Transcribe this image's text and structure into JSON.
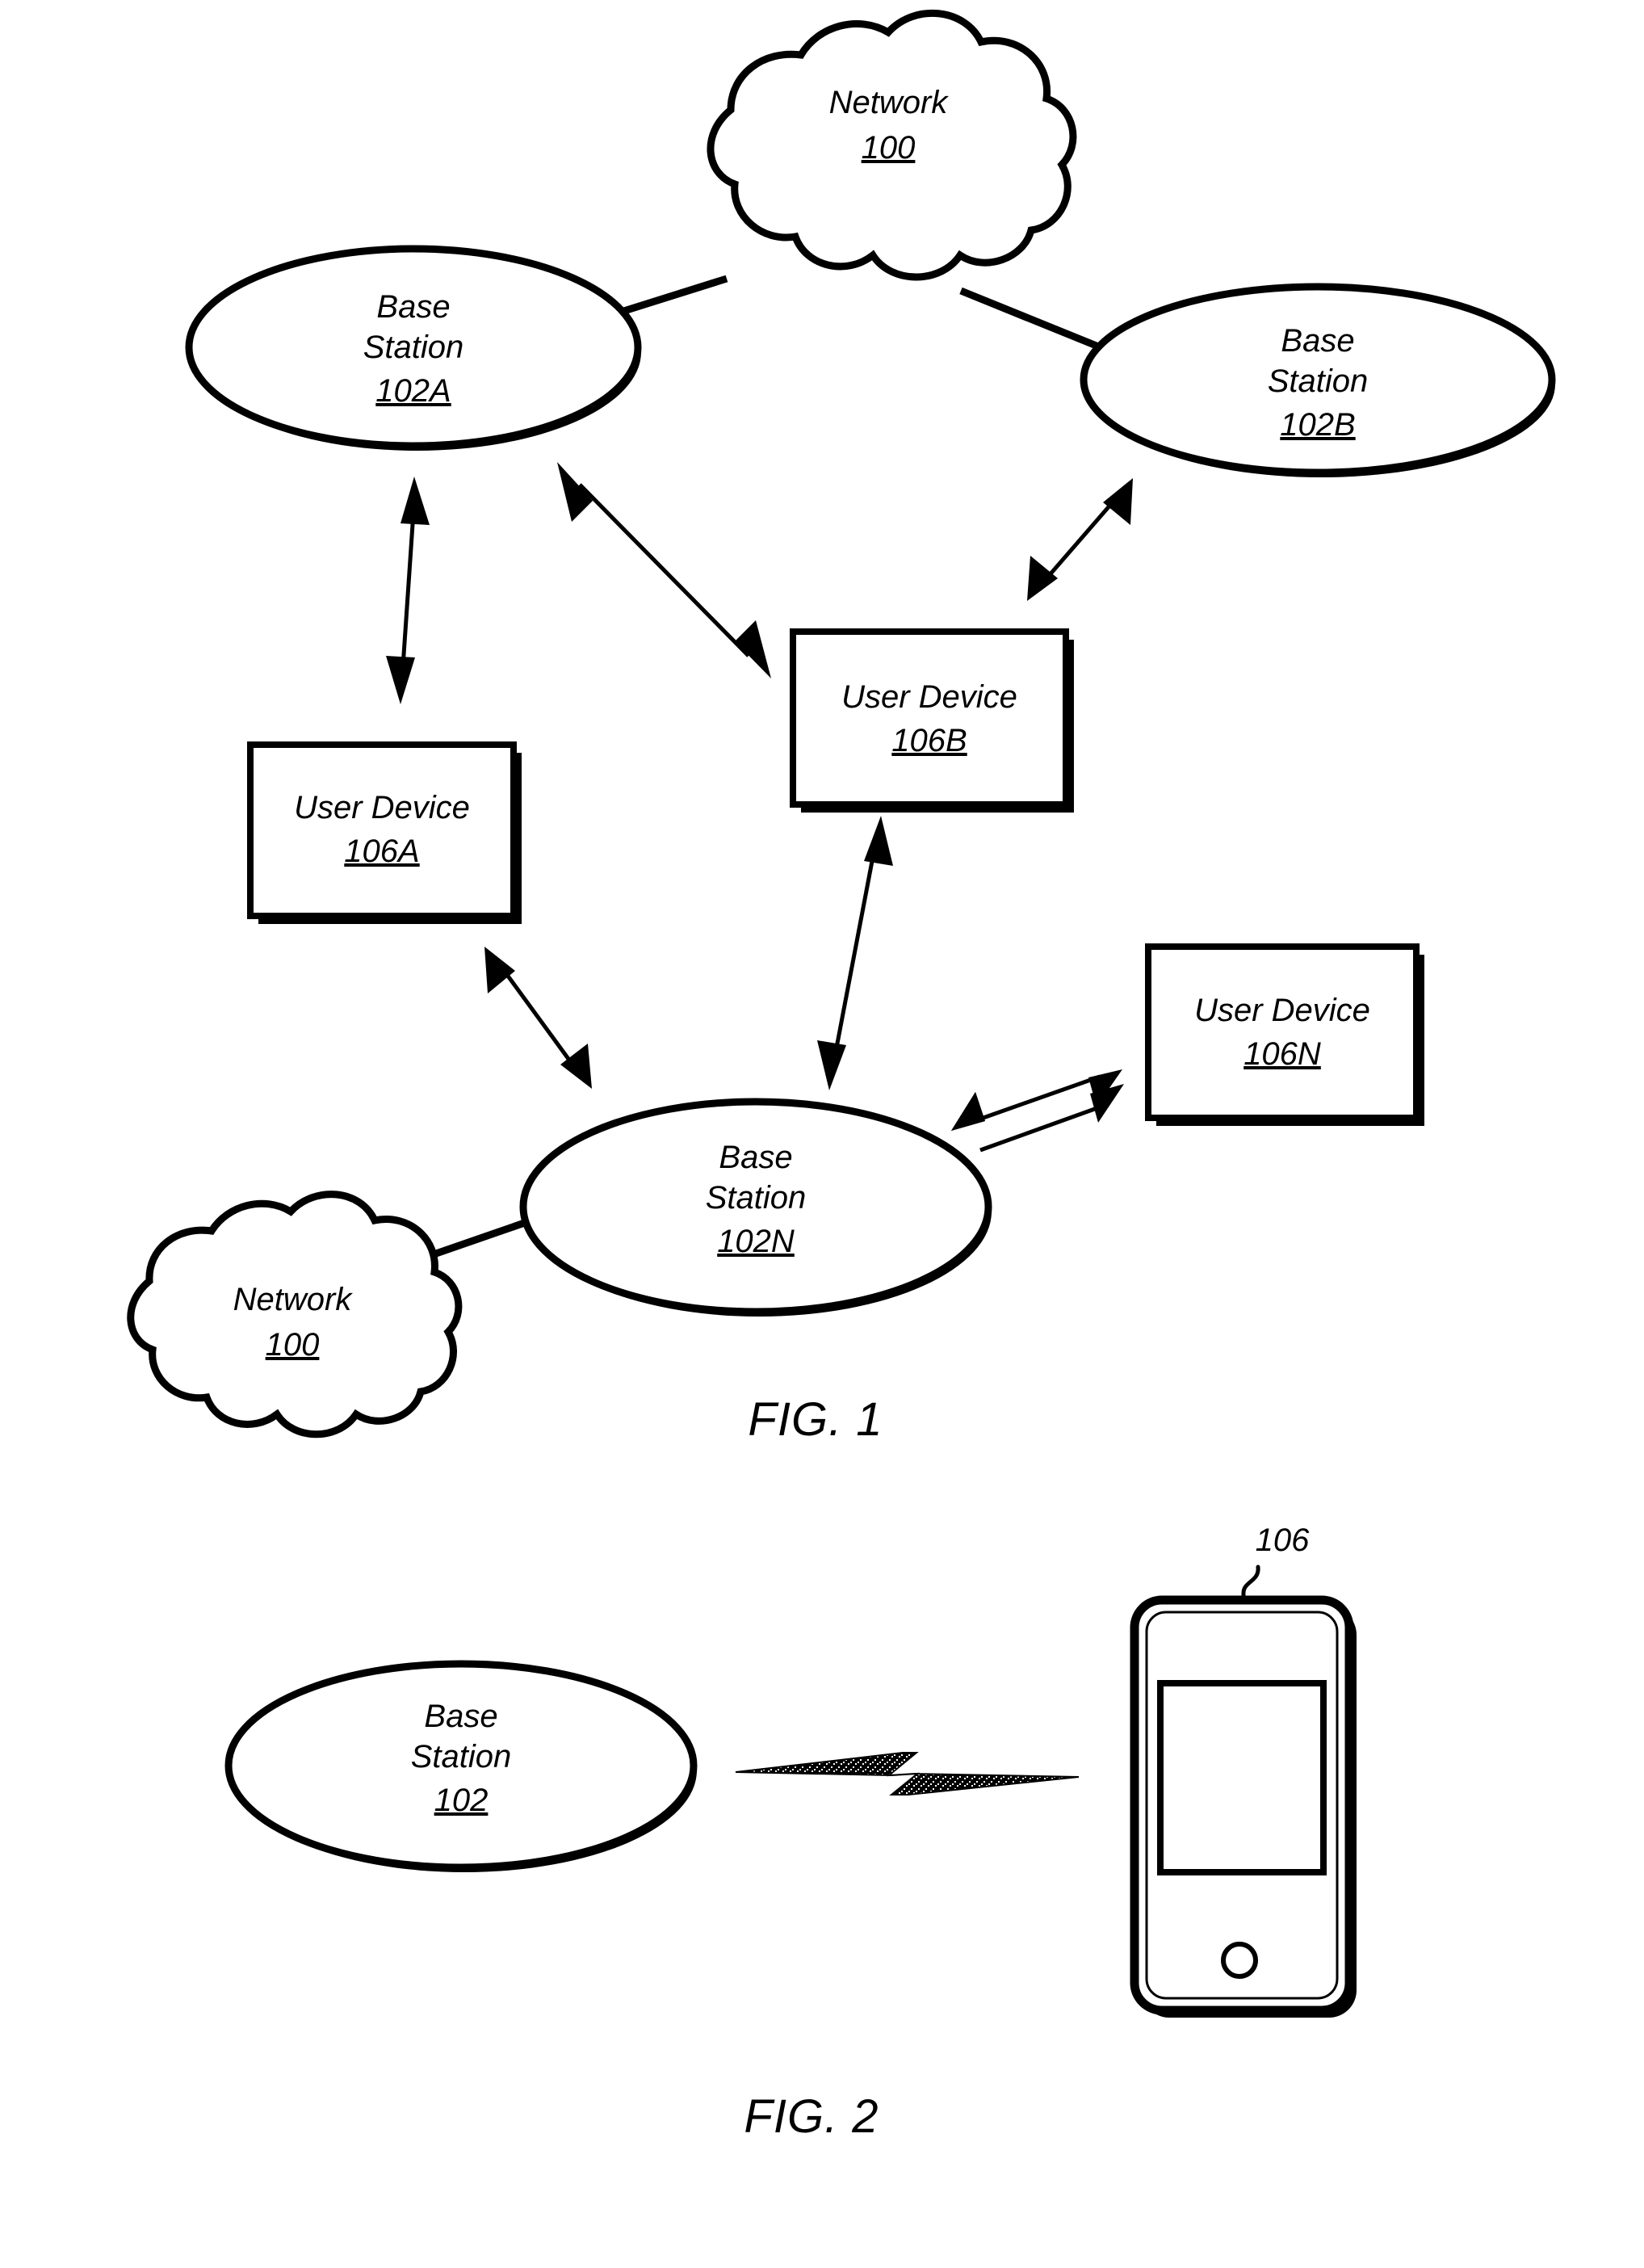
{
  "document": {
    "kind": "patent-figure-sheet",
    "figures": [
      "FIG. 1",
      "FIG. 2"
    ]
  },
  "fig1": {
    "caption": "FIG. 1",
    "nodes": {
      "network_top": {
        "title": "Network",
        "ref": "100",
        "shape": "cloud"
      },
      "network_bottom": {
        "title": "Network",
        "ref": "100",
        "shape": "cloud"
      },
      "base_station_a": {
        "title_line1": "Base",
        "title_line2": "Station",
        "ref": "102A",
        "shape": "ellipse"
      },
      "base_station_b": {
        "title_line1": "Base",
        "title_line2": "Station",
        "ref": "102B",
        "shape": "ellipse"
      },
      "base_station_n": {
        "title_line1": "Base",
        "title_line2": "Station",
        "ref": "102N",
        "shape": "ellipse"
      },
      "user_device_a": {
        "title": "User Device",
        "ref": "106A",
        "shape": "rectangle"
      },
      "user_device_b": {
        "title": "User Device",
        "ref": "106B",
        "shape": "rectangle"
      },
      "user_device_n": {
        "title": "User Device",
        "ref": "106N",
        "shape": "rectangle"
      }
    },
    "links": [
      {
        "from": "network_top",
        "to": "base_station_a",
        "style": "solid-line"
      },
      {
        "from": "network_top",
        "to": "base_station_b",
        "style": "solid-line"
      },
      {
        "from": "network_bottom",
        "to": "base_station_n",
        "style": "solid-line"
      },
      {
        "from": "base_station_a",
        "to": "user_device_a",
        "style": "double-arrow"
      },
      {
        "from": "base_station_a",
        "to": "user_device_b",
        "style": "double-arrow"
      },
      {
        "from": "base_station_b",
        "to": "user_device_b",
        "style": "double-arrow"
      },
      {
        "from": "user_device_a",
        "to": "base_station_n",
        "style": "double-arrow"
      },
      {
        "from": "user_device_b",
        "to": "base_station_n",
        "style": "double-arrow"
      },
      {
        "from": "base_station_n",
        "to": "user_device_n",
        "style": "double-arrow"
      },
      {
        "from": "base_station_n",
        "to": "user_device_n",
        "style": "double-arrow"
      }
    ]
  },
  "fig2": {
    "caption": "FIG. 2",
    "nodes": {
      "base_station": {
        "title_line1": "Base",
        "title_line2": "Station",
        "ref": "102",
        "shape": "ellipse"
      },
      "user_device_phone": {
        "ref": "106",
        "shape": "mobile-phone"
      }
    },
    "links": [
      {
        "from": "base_station",
        "to": "user_device_phone",
        "style": "lightning-bolt"
      }
    ]
  },
  "colors": {
    "ink": "#000000",
    "paper": "#ffffff"
  }
}
